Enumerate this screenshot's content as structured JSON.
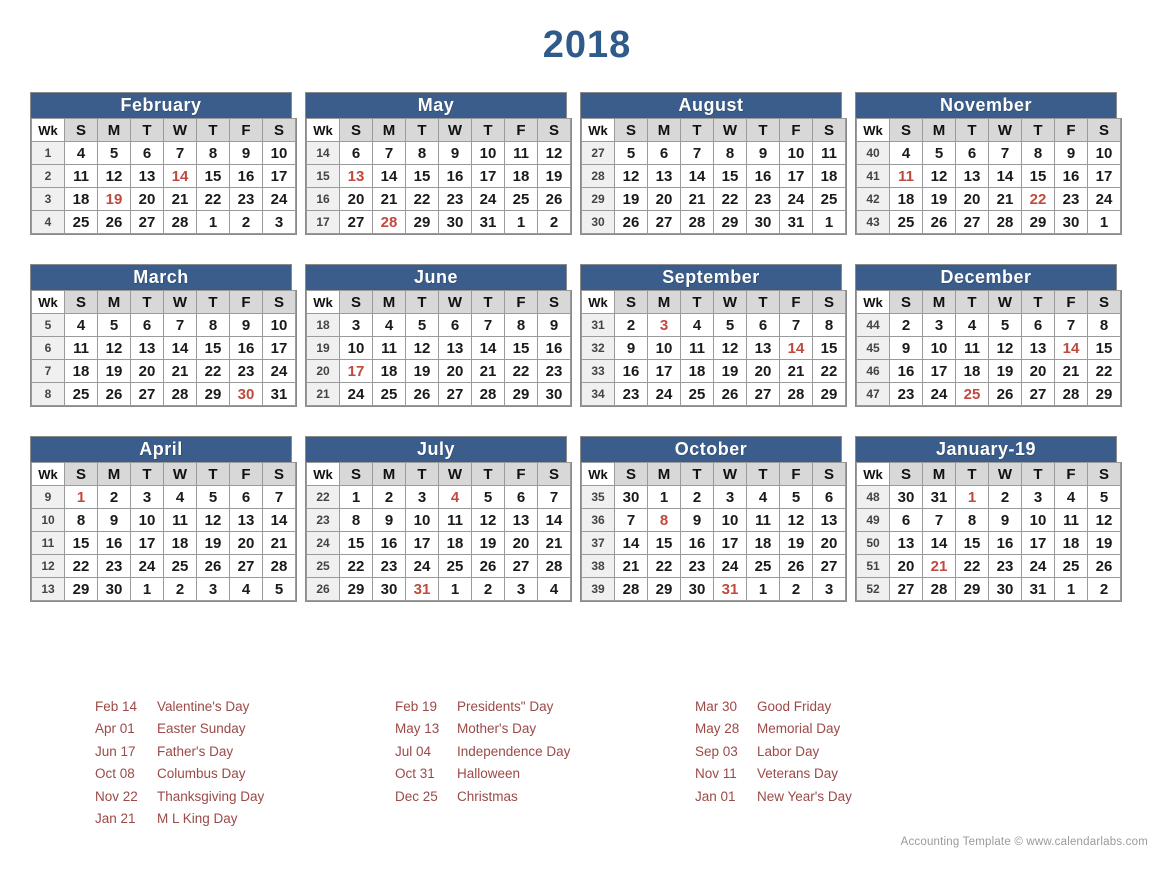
{
  "title": "2018",
  "footer": "Accounting Template © www.calendarlabs.com",
  "colors": {
    "header_blue": "#3b5d8b",
    "title_blue": "#2e5b8a",
    "holiday_red": "#c04a3e",
    "legend_red": "#9b4a47",
    "week_cell_gray": "#f0f0f0",
    "weekday_head_gray": "#d8d8d8",
    "footer_gray": "#9a9a9a"
  },
  "weekday_headers": [
    "Wk",
    "S",
    "M",
    "T",
    "W",
    "T",
    "F",
    "S"
  ],
  "months": [
    {
      "name": "February",
      "weeks": [
        {
          "wk": "1",
          "days": [
            "4",
            "5",
            "6",
            "7",
            "8",
            "9",
            "10"
          ],
          "holidays": []
        },
        {
          "wk": "2",
          "days": [
            "11",
            "12",
            "13",
            "14",
            "15",
            "16",
            "17"
          ],
          "holidays": [
            3
          ]
        },
        {
          "wk": "3",
          "days": [
            "18",
            "19",
            "20",
            "21",
            "22",
            "23",
            "24"
          ],
          "holidays": [
            1
          ]
        },
        {
          "wk": "4",
          "days": [
            "25",
            "26",
            "27",
            "28",
            "1",
            "2",
            "3"
          ],
          "holidays": []
        }
      ]
    },
    {
      "name": "May",
      "weeks": [
        {
          "wk": "14",
          "days": [
            "6",
            "7",
            "8",
            "9",
            "10",
            "11",
            "12"
          ],
          "holidays": []
        },
        {
          "wk": "15",
          "days": [
            "13",
            "14",
            "15",
            "16",
            "17",
            "18",
            "19"
          ],
          "holidays": [
            0
          ]
        },
        {
          "wk": "16",
          "days": [
            "20",
            "21",
            "22",
            "23",
            "24",
            "25",
            "26"
          ],
          "holidays": []
        },
        {
          "wk": "17",
          "days": [
            "27",
            "28",
            "29",
            "30",
            "31",
            "1",
            "2"
          ],
          "holidays": [
            1
          ]
        }
      ]
    },
    {
      "name": "August",
      "weeks": [
        {
          "wk": "27",
          "days": [
            "5",
            "6",
            "7",
            "8",
            "9",
            "10",
            "11"
          ],
          "holidays": []
        },
        {
          "wk": "28",
          "days": [
            "12",
            "13",
            "14",
            "15",
            "16",
            "17",
            "18"
          ],
          "holidays": []
        },
        {
          "wk": "29",
          "days": [
            "19",
            "20",
            "21",
            "22",
            "23",
            "24",
            "25"
          ],
          "holidays": []
        },
        {
          "wk": "30",
          "days": [
            "26",
            "27",
            "28",
            "29",
            "30",
            "31",
            "1"
          ],
          "holidays": []
        }
      ]
    },
    {
      "name": "November",
      "weeks": [
        {
          "wk": "40",
          "days": [
            "4",
            "5",
            "6",
            "7",
            "8",
            "9",
            "10"
          ],
          "holidays": []
        },
        {
          "wk": "41",
          "days": [
            "11",
            "12",
            "13",
            "14",
            "15",
            "16",
            "17"
          ],
          "holidays": [
            0
          ]
        },
        {
          "wk": "42",
          "days": [
            "18",
            "19",
            "20",
            "21",
            "22",
            "23",
            "24"
          ],
          "holidays": [
            4
          ]
        },
        {
          "wk": "43",
          "days": [
            "25",
            "26",
            "27",
            "28",
            "29",
            "30",
            "1"
          ],
          "holidays": []
        }
      ]
    },
    {
      "name": "March",
      "weeks": [
        {
          "wk": "5",
          "days": [
            "4",
            "5",
            "6",
            "7",
            "8",
            "9",
            "10"
          ],
          "holidays": []
        },
        {
          "wk": "6",
          "days": [
            "11",
            "12",
            "13",
            "14",
            "15",
            "16",
            "17"
          ],
          "holidays": []
        },
        {
          "wk": "7",
          "days": [
            "18",
            "19",
            "20",
            "21",
            "22",
            "23",
            "24"
          ],
          "holidays": []
        },
        {
          "wk": "8",
          "days": [
            "25",
            "26",
            "27",
            "28",
            "29",
            "30",
            "31"
          ],
          "holidays": [
            5
          ]
        }
      ]
    },
    {
      "name": "June",
      "weeks": [
        {
          "wk": "18",
          "days": [
            "3",
            "4",
            "5",
            "6",
            "7",
            "8",
            "9"
          ],
          "holidays": []
        },
        {
          "wk": "19",
          "days": [
            "10",
            "11",
            "12",
            "13",
            "14",
            "15",
            "16"
          ],
          "holidays": []
        },
        {
          "wk": "20",
          "days": [
            "17",
            "18",
            "19",
            "20",
            "21",
            "22",
            "23"
          ],
          "holidays": [
            0
          ]
        },
        {
          "wk": "21",
          "days": [
            "24",
            "25",
            "26",
            "27",
            "28",
            "29",
            "30"
          ],
          "holidays": []
        }
      ]
    },
    {
      "name": "September",
      "weeks": [
        {
          "wk": "31",
          "days": [
            "2",
            "3",
            "4",
            "5",
            "6",
            "7",
            "8"
          ],
          "holidays": [
            1
          ]
        },
        {
          "wk": "32",
          "days": [
            "9",
            "10",
            "11",
            "12",
            "13",
            "14",
            "15"
          ],
          "holidays": [
            5
          ]
        },
        {
          "wk": "33",
          "days": [
            "16",
            "17",
            "18",
            "19",
            "20",
            "21",
            "22"
          ],
          "holidays": []
        },
        {
          "wk": "34",
          "days": [
            "23",
            "24",
            "25",
            "26",
            "27",
            "28",
            "29"
          ],
          "holidays": []
        }
      ]
    },
    {
      "name": "December",
      "weeks": [
        {
          "wk": "44",
          "days": [
            "2",
            "3",
            "4",
            "5",
            "6",
            "7",
            "8"
          ],
          "holidays": []
        },
        {
          "wk": "45",
          "days": [
            "9",
            "10",
            "11",
            "12",
            "13",
            "14",
            "15"
          ],
          "holidays": [
            5
          ]
        },
        {
          "wk": "46",
          "days": [
            "16",
            "17",
            "18",
            "19",
            "20",
            "21",
            "22"
          ],
          "holidays": []
        },
        {
          "wk": "47",
          "days": [
            "23",
            "24",
            "25",
            "26",
            "27",
            "28",
            "29"
          ],
          "holidays": [
            2
          ]
        }
      ]
    },
    {
      "name": "April",
      "weeks": [
        {
          "wk": "9",
          "days": [
            "1",
            "2",
            "3",
            "4",
            "5",
            "6",
            "7"
          ],
          "holidays": [
            0
          ]
        },
        {
          "wk": "10",
          "days": [
            "8",
            "9",
            "10",
            "11",
            "12",
            "13",
            "14"
          ],
          "holidays": []
        },
        {
          "wk": "11",
          "days": [
            "15",
            "16",
            "17",
            "18",
            "19",
            "20",
            "21"
          ],
          "holidays": []
        },
        {
          "wk": "12",
          "days": [
            "22",
            "23",
            "24",
            "25",
            "26",
            "27",
            "28"
          ],
          "holidays": []
        },
        {
          "wk": "13",
          "days": [
            "29",
            "30",
            "1",
            "2",
            "3",
            "4",
            "5"
          ],
          "holidays": []
        }
      ]
    },
    {
      "name": "July",
      "weeks": [
        {
          "wk": "22",
          "days": [
            "1",
            "2",
            "3",
            "4",
            "5",
            "6",
            "7"
          ],
          "holidays": [
            3
          ]
        },
        {
          "wk": "23",
          "days": [
            "8",
            "9",
            "10",
            "11",
            "12",
            "13",
            "14"
          ],
          "holidays": []
        },
        {
          "wk": "24",
          "days": [
            "15",
            "16",
            "17",
            "18",
            "19",
            "20",
            "21"
          ],
          "holidays": []
        },
        {
          "wk": "25",
          "days": [
            "22",
            "23",
            "24",
            "25",
            "26",
            "27",
            "28"
          ],
          "holidays": []
        },
        {
          "wk": "26",
          "days": [
            "29",
            "30",
            "31",
            "1",
            "2",
            "3",
            "4"
          ],
          "holidays": [
            2
          ]
        }
      ]
    },
    {
      "name": "October",
      "weeks": [
        {
          "wk": "35",
          "days": [
            "30",
            "1",
            "2",
            "3",
            "4",
            "5",
            "6"
          ],
          "holidays": []
        },
        {
          "wk": "36",
          "days": [
            "7",
            "8",
            "9",
            "10",
            "11",
            "12",
            "13"
          ],
          "holidays": [
            1
          ]
        },
        {
          "wk": "37",
          "days": [
            "14",
            "15",
            "16",
            "17",
            "18",
            "19",
            "20"
          ],
          "holidays": []
        },
        {
          "wk": "38",
          "days": [
            "21",
            "22",
            "23",
            "24",
            "25",
            "26",
            "27"
          ],
          "holidays": []
        },
        {
          "wk": "39",
          "days": [
            "28",
            "29",
            "30",
            "31",
            "1",
            "2",
            "3"
          ],
          "holidays": [
            3
          ]
        }
      ]
    },
    {
      "name": "January-19",
      "weeks": [
        {
          "wk": "48",
          "days": [
            "30",
            "31",
            "1",
            "2",
            "3",
            "4",
            "5"
          ],
          "holidays": [
            2
          ]
        },
        {
          "wk": "49",
          "days": [
            "6",
            "7",
            "8",
            "9",
            "10",
            "11",
            "12"
          ],
          "holidays": []
        },
        {
          "wk": "50",
          "days": [
            "13",
            "14",
            "15",
            "16",
            "17",
            "18",
            "19"
          ],
          "holidays": []
        },
        {
          "wk": "51",
          "days": [
            "20",
            "21",
            "22",
            "23",
            "24",
            "25",
            "26"
          ],
          "holidays": [
            1
          ]
        },
        {
          "wk": "52",
          "days": [
            "27",
            "28",
            "29",
            "30",
            "31",
            "1",
            "2"
          ],
          "holidays": []
        }
      ]
    }
  ],
  "legend_columns": [
    [
      {
        "date": "Feb 14",
        "name": "Valentine's Day"
      },
      {
        "date": "Apr 01",
        "name": "Easter Sunday"
      },
      {
        "date": "Jun 17",
        "name": "Father's Day"
      },
      {
        "date": "Oct 08",
        "name": "Columbus Day"
      },
      {
        "date": "Nov 22",
        "name": "Thanksgiving Day"
      },
      {
        "date": "Jan 21",
        "name": "M L King Day"
      }
    ],
    [
      {
        "date": "Feb 19",
        "name": "Presidents\" Day"
      },
      {
        "date": "May 13",
        "name": "Mother's Day"
      },
      {
        "date": "Jul 04",
        "name": "Independence Day"
      },
      {
        "date": "Oct 31",
        "name": "Halloween"
      },
      {
        "date": "Dec 25",
        "name": "Christmas"
      }
    ],
    [
      {
        "date": "Mar 30",
        "name": "Good Friday"
      },
      {
        "date": "May 28",
        "name": "Memorial Day"
      },
      {
        "date": "Sep 03",
        "name": "Labor Day"
      },
      {
        "date": "Nov 11",
        "name": "Veterans Day"
      },
      {
        "date": "Jan 01",
        "name": "New Year's Day"
      }
    ]
  ]
}
